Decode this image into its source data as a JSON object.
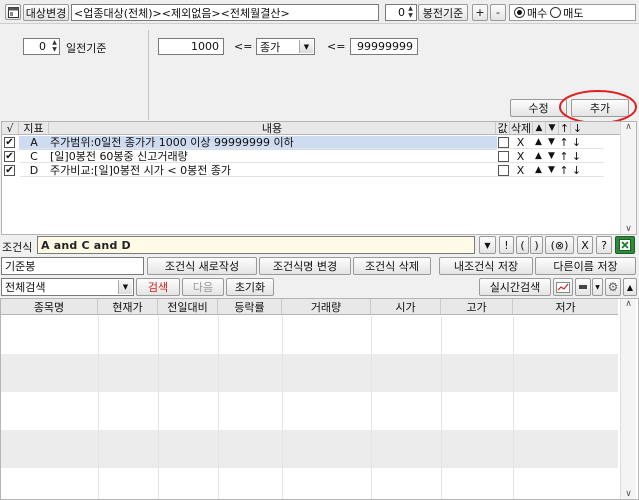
{
  "top_bar": {
    "icon": "window-icon",
    "target_change_label": "대상변경",
    "target_field": "<업종대상(전체)><제외없음><전체월결산>",
    "bong_value": "0",
    "bong_basis_label": "봉전기준",
    "plus_label": "+",
    "minus_label": "-",
    "buy_label": "매수",
    "sell_label": "매도",
    "buy_selected": true
  },
  "condition_editor": {
    "day_value": "0",
    "day_basis_label": "일전기준",
    "min_value": "1000",
    "lte_1": "<=",
    "price_select": "종가",
    "lte_2": "<=",
    "max_value": "99999999",
    "edit_label": "수정",
    "add_label": "추가",
    "highlight_color": "#e02020"
  },
  "condition_table": {
    "headers": {
      "check": "√",
      "indicator": "지표",
      "content": "내용",
      "value": "값",
      "delete": "삭제",
      "up": "▲",
      "down": "▼",
      "move_up": "↑",
      "move_down": "↓"
    },
    "rows": [
      {
        "checked": "✔",
        "letter": "A",
        "content": "주가범위:0일전 종가가 1000 이상 99999999 이하",
        "delete": "X",
        "up": "▲",
        "down": "▼",
        "move_up": "↑",
        "move_down": "↓"
      },
      {
        "checked": "✔",
        "letter": "C",
        "content": "[일]0봉전 60봉중 신고거래량",
        "delete": "X",
        "up": "▲",
        "down": "▼",
        "move_up": "↑",
        "move_down": "↓"
      },
      {
        "checked": "✔",
        "letter": "D",
        "content": "주가비교:[일]0봉전 시가 < 0봉전 종가",
        "delete": "X",
        "up": "▲",
        "down": "▼",
        "move_up": "↑",
        "move_down": "↓"
      }
    ]
  },
  "formula_bar": {
    "label": "조건식",
    "formula": "A and C and D",
    "buttons": [
      "▼",
      "!",
      "(",
      ")",
      "(⊗)",
      "X",
      "?"
    ]
  },
  "action_bar": {
    "name_field": "기준봉",
    "new_label": "조건식 새로작성",
    "rename_label": "조건식명 변경",
    "delete_label": "조건식 삭제",
    "save_label": "내조건식 저장",
    "save_as_label": "다른이름 저장"
  },
  "search_bar": {
    "scope_select": "전체검색",
    "search_label": "검색",
    "next_label": "다음",
    "reset_label": "초기화",
    "realtime_label": "실시간검색"
  },
  "results_table": {
    "columns": [
      "종목명",
      "현재가",
      "전일대비",
      "등락률",
      "거래량",
      "시가",
      "고가",
      "저가"
    ]
  }
}
